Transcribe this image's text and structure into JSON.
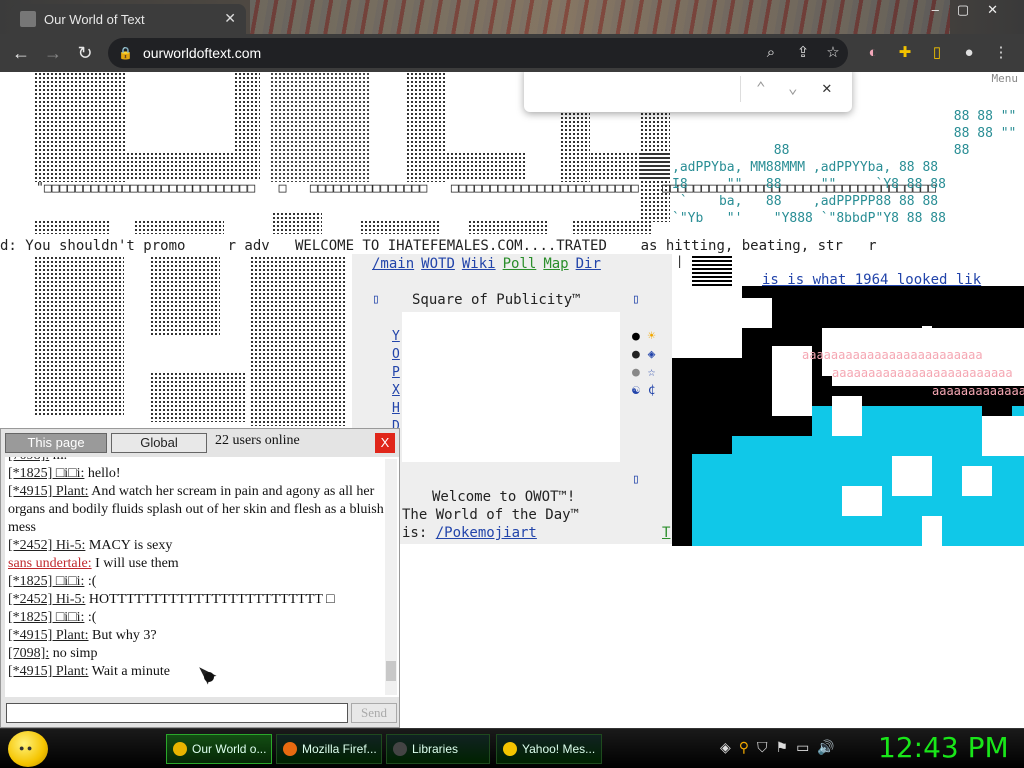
{
  "browser": {
    "tab_title": "Our World of Text",
    "url": "ourworldoftext.com"
  },
  "banner": {
    "left_text": "d: You shouldn't promo     r adv   WELCOME TO IHATEFEMALES.COM....TRATED    as hitting, beating, str   r"
  },
  "ascii_right": [
    "                                    88 88 \"\"",
    "                                    88 88 \"\"",
    "             88                     88",
    ",adPPYba, MM88MMM ,adPPYYba, 88 88 ",
    "I8     \"\"   88     \"\"     `Y8 88 88 ",
    " `    ba,   88    ,adPPPPP88 88 88 ",
    "",
    "`\"Yb   \"'    \"Y888 `\"8bbdP\"Y8 88 88 "
  ],
  "main_links": [
    "/main",
    "WOTD",
    "Wiki",
    "Poll",
    "Map",
    "Dir"
  ],
  "square": {
    "title": "Square of Publicity™",
    "letters": [
      "Y",
      "O",
      "P",
      "X",
      "H",
      "D"
    ]
  },
  "welcome": {
    "line1": "Welcome to OWOT™!",
    "line2": "The World of the Day™",
    "line3": "is: ",
    "wotd_link": "/Pokemojiart",
    "trail": "T"
  },
  "year_link": "is is what 1964 looked lik",
  "pink_text": "aaaaaaaaaaaaaaaaaaaaaaaaa",
  "menu_label": "Menu",
  "chat": {
    "tab_this_page": "This page",
    "tab_global": "Global",
    "online": "22 users online",
    "close": "X",
    "send": "Send",
    "messages": [
      {
        "nick": "[7098]:",
        "text": "m.",
        "partial": true
      },
      {
        "nick": "[*1825] □i□i:",
        "text": "hello!"
      },
      {
        "nick": "[*4915] Plant:",
        "text": "And watch her scream in pain and agony as all her organs and bodily fluids splash out of her skin and flesh as a bluish mess"
      },
      {
        "nick": "[*2452] Hi-5:",
        "text": "MACY is sexy"
      },
      {
        "nick": "sans undertale:",
        "text": "I will use them",
        "red": true
      },
      {
        "nick": "[*1825] □i□i:",
        "text": ":("
      },
      {
        "nick": "[*2452] Hi-5:",
        "text": "HOTTTTTTTTTTTTTTTTTTTTTTTTT □"
      },
      {
        "nick": "[*1825] □i□i:",
        "text": ":("
      },
      {
        "nick": "[*4915] Plant:",
        "text": "But why 3?"
      },
      {
        "nick": "[7098]:",
        "text": "no simp"
      },
      {
        "nick": "[*4915] Plant:",
        "text": "Wait a minute"
      }
    ]
  },
  "taskbar": {
    "tasks": [
      {
        "label": "Our World o...",
        "color": "#e8b400"
      },
      {
        "label": "Mozilla Firef...",
        "color": "#e86a10"
      },
      {
        "label": "Libraries",
        "color": "#444"
      },
      {
        "label": "Yahoo! Mes...",
        "color": "#f5c400"
      }
    ],
    "clock": "12:43 PM"
  },
  "colors": {
    "accent_teal": "#2a8e95",
    "link_blue": "#2244aa",
    "cyan_art": "#10c8e8",
    "clock_green": "#19e619",
    "chat_close_red": "#e0261a"
  }
}
